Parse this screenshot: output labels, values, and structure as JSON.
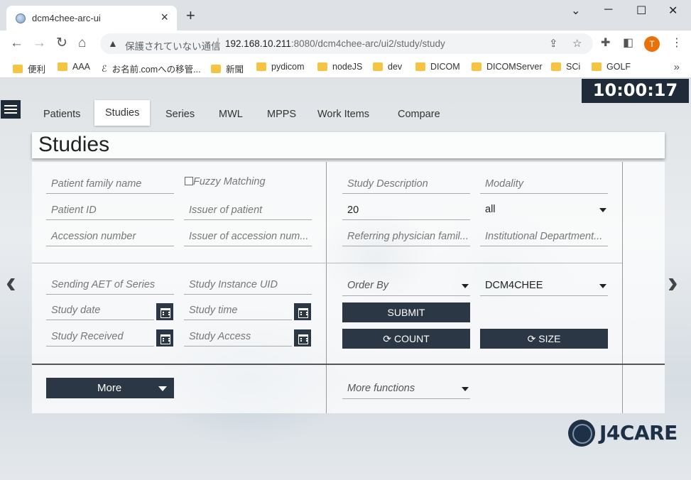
{
  "browser": {
    "tab_title": "dcm4chee-arc-ui",
    "new_tab": "+",
    "window_controls": {
      "minimize": "─",
      "maximize": "☐",
      "close": "✕",
      "tab_list": "⌄"
    },
    "security_label": "保護されていない通信",
    "url_host": "192.168.10.211",
    "url_rest": ":8080/dcm4chee-arc/ui2/study/study",
    "profile_initial": "T",
    "bookmarks": [
      "便利",
      "AAA",
      "お名前.comへの移管...",
      "新聞",
      "pydicom",
      "nodeJS",
      "dev",
      "DICOM",
      "DICOMServer",
      "SCi",
      "GOLF"
    ],
    "bookmarks_more": "»"
  },
  "app": {
    "clock": "10:00:17",
    "nav_tabs": [
      "Patients",
      "Studies",
      "Series",
      "MWL",
      "MPPS",
      "Work Items",
      "Compare"
    ],
    "active_tab": "Studies",
    "page_title": "Studies",
    "filters": {
      "patient_family_name": "Patient family name",
      "fuzzy_matching": "Fuzzy Matching",
      "patient_id": "Patient ID",
      "issuer_of_patient": "Issuer of patient",
      "accession_number": "Accession number",
      "issuer_of_accession": "Issuer of accession num...",
      "study_description": "Study Description",
      "modality": "Modality",
      "limit_value": "20",
      "modality_select": "all",
      "referring_physician": "Referring physician famil...",
      "institutional_department": "Institutional Department...",
      "sending_aet": "Sending AET of Series",
      "study_instance_uid": "Study Instance UID",
      "study_date": "Study date",
      "study_time": "Study time",
      "study_received": "Study Received",
      "study_access": "Study Access",
      "order_by": "Order By",
      "aet_select": "DCM4CHEE"
    },
    "buttons": {
      "submit": "SUBMIT",
      "count": "COUNT",
      "size": "SIZE",
      "more": "More",
      "more_functions": "More functions"
    },
    "logo_text": "J4CARE",
    "colors": {
      "dark": "#2b3744",
      "clock_bg": "#1f2b38",
      "profile": "#e8710a",
      "folder": "#f6c443"
    }
  }
}
